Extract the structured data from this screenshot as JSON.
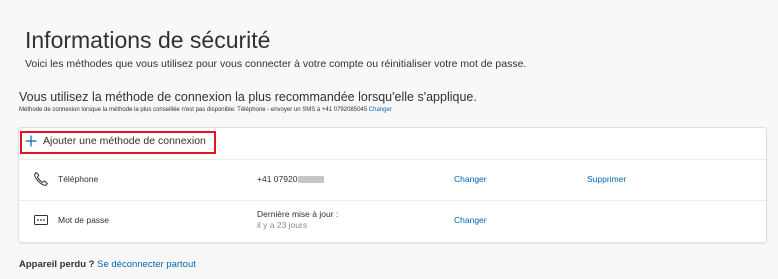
{
  "header": {
    "title": "Informations de sécurité",
    "subtitle": "Voici les méthodes que vous utilisez pour vous connecter à votre compte ou réinitialiser votre mot de passe."
  },
  "default_method": {
    "heading": "Vous utilisez la méthode de connexion la plus recommandée lorsqu'elle s'applique.",
    "detail": "Méthode de connexion lorsque la méthode la plus conseillée n'est pas disponible: Téléphone - envoyer un SMS à +41 0792085045",
    "change_link": "Changer"
  },
  "methods_card": {
    "add_label": "Ajouter une méthode de connexion",
    "methods": [
      {
        "name": "Téléphone",
        "icon": "phone-icon",
        "detail": "+41 07920",
        "change": "Changer",
        "delete": "Supprimer"
      },
      {
        "name": "Mot de passe",
        "icon": "password-icon",
        "detail": "Dernière mise à jour :",
        "detail_sub": "il y a 23 jours",
        "change": "Changer"
      }
    ]
  },
  "footer": {
    "question": "Appareil perdu ?",
    "link": "Se déconnecter partout"
  },
  "colors": {
    "accent": "#0067b8",
    "highlight": "#e81123",
    "background": "#f8f8f8"
  }
}
